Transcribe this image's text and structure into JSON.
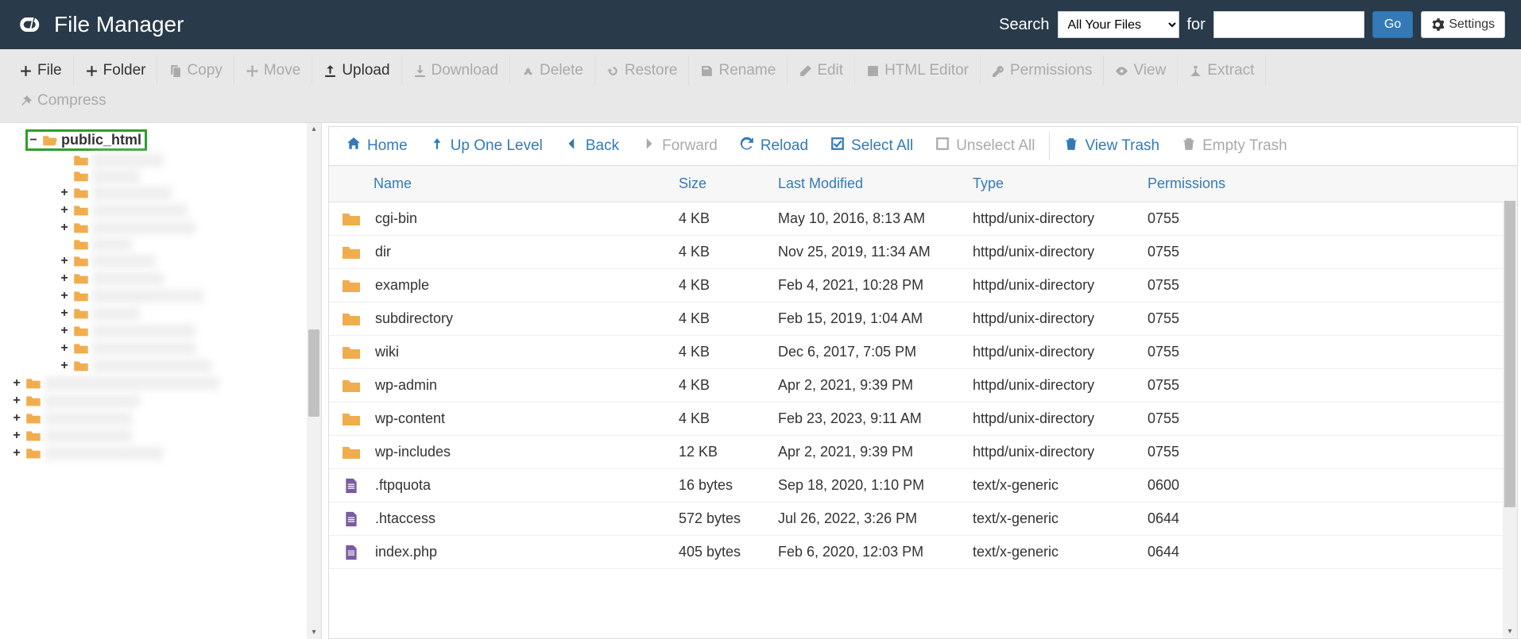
{
  "header": {
    "title": "File Manager",
    "search_label": "Search",
    "search_scope": "All Your Files",
    "for_label": "for",
    "search_value": "",
    "go_label": "Go",
    "settings_label": "Settings"
  },
  "toolbar": [
    {
      "id": "file",
      "label": "File",
      "icon": "plus",
      "enabled": true
    },
    {
      "id": "folder",
      "label": "Folder",
      "icon": "plus",
      "enabled": true
    },
    {
      "id": "copy",
      "label": "Copy",
      "icon": "copy",
      "enabled": false
    },
    {
      "id": "move",
      "label": "Move",
      "icon": "move",
      "enabled": false
    },
    {
      "id": "upload",
      "label": "Upload",
      "icon": "upload",
      "enabled": true
    },
    {
      "id": "download",
      "label": "Download",
      "icon": "download",
      "enabled": false
    },
    {
      "id": "delete",
      "label": "Delete",
      "icon": "delete",
      "enabled": false
    },
    {
      "id": "restore",
      "label": "Restore",
      "icon": "restore",
      "enabled": false
    },
    {
      "id": "rename",
      "label": "Rename",
      "icon": "rename",
      "enabled": false
    },
    {
      "id": "edit",
      "label": "Edit",
      "icon": "edit",
      "enabled": false
    },
    {
      "id": "htmleditor",
      "label": "HTML Editor",
      "icon": "htmleditor",
      "enabled": false
    },
    {
      "id": "permissions",
      "label": "Permissions",
      "icon": "permissions",
      "enabled": false
    },
    {
      "id": "view",
      "label": "View",
      "icon": "view",
      "enabled": false
    },
    {
      "id": "extract",
      "label": "Extract",
      "icon": "extract",
      "enabled": false
    },
    {
      "id": "compress",
      "label": "Compress",
      "icon": "compress",
      "enabled": false
    }
  ],
  "tree": {
    "root_label": "public_html"
  },
  "actionbar": [
    {
      "id": "home",
      "label": "Home",
      "icon": "home",
      "enabled": true
    },
    {
      "id": "up",
      "label": "Up One Level",
      "icon": "up",
      "enabled": true
    },
    {
      "id": "back",
      "label": "Back",
      "icon": "back",
      "enabled": true
    },
    {
      "id": "forward",
      "label": "Forward",
      "icon": "forward",
      "enabled": false
    },
    {
      "id": "reload",
      "label": "Reload",
      "icon": "reload",
      "enabled": true
    },
    {
      "id": "selectall",
      "label": "Select All",
      "icon": "selectall",
      "enabled": true
    },
    {
      "id": "unselectall",
      "label": "Unselect All",
      "icon": "unselectall",
      "enabled": false
    },
    {
      "id": "viewtrash",
      "label": "View Trash",
      "icon": "trash",
      "enabled": true,
      "sep": true
    },
    {
      "id": "emptytrash",
      "label": "Empty Trash",
      "icon": "trash",
      "enabled": false
    }
  ],
  "columns": {
    "name": "Name",
    "size": "Size",
    "modified": "Last Modified",
    "type": "Type",
    "permissions": "Permissions"
  },
  "files": [
    {
      "icon": "folder",
      "name": "cgi-bin",
      "size": "4 KB",
      "modified": "May 10, 2016, 8:13 AM",
      "type": "httpd/unix-directory",
      "perm": "0755"
    },
    {
      "icon": "folder",
      "name": "dir",
      "size": "4 KB",
      "modified": "Nov 25, 2019, 11:34 AM",
      "type": "httpd/unix-directory",
      "perm": "0755"
    },
    {
      "icon": "folder",
      "name": "example",
      "size": "4 KB",
      "modified": "Feb 4, 2021, 10:28 PM",
      "type": "httpd/unix-directory",
      "perm": "0755"
    },
    {
      "icon": "folder",
      "name": "subdirectory",
      "size": "4 KB",
      "modified": "Feb 15, 2019, 1:04 AM",
      "type": "httpd/unix-directory",
      "perm": "0755"
    },
    {
      "icon": "folder",
      "name": "wiki",
      "size": "4 KB",
      "modified": "Dec 6, 2017, 7:05 PM",
      "type": "httpd/unix-directory",
      "perm": "0755"
    },
    {
      "icon": "folder",
      "name": "wp-admin",
      "size": "4 KB",
      "modified": "Apr 2, 2021, 9:39 PM",
      "type": "httpd/unix-directory",
      "perm": "0755"
    },
    {
      "icon": "folder",
      "name": "wp-content",
      "size": "4 KB",
      "modified": "Feb 23, 2023, 9:11 AM",
      "type": "httpd/unix-directory",
      "perm": "0755"
    },
    {
      "icon": "folder",
      "name": "wp-includes",
      "size": "12 KB",
      "modified": "Apr 2, 2021, 9:39 PM",
      "type": "httpd/unix-directory",
      "perm": "0755"
    },
    {
      "icon": "file",
      "name": ".ftpquota",
      "size": "16 bytes",
      "modified": "Sep 18, 2020, 1:10 PM",
      "type": "text/x-generic",
      "perm": "0600"
    },
    {
      "icon": "file",
      "name": ".htaccess",
      "size": "572 bytes",
      "modified": "Jul 26, 2022, 3:26 PM",
      "type": "text/x-generic",
      "perm": "0644"
    },
    {
      "icon": "file",
      "name": "index.php",
      "size": "405 bytes",
      "modified": "Feb 6, 2020, 12:03 PM",
      "type": "text/x-generic",
      "perm": "0644"
    }
  ]
}
